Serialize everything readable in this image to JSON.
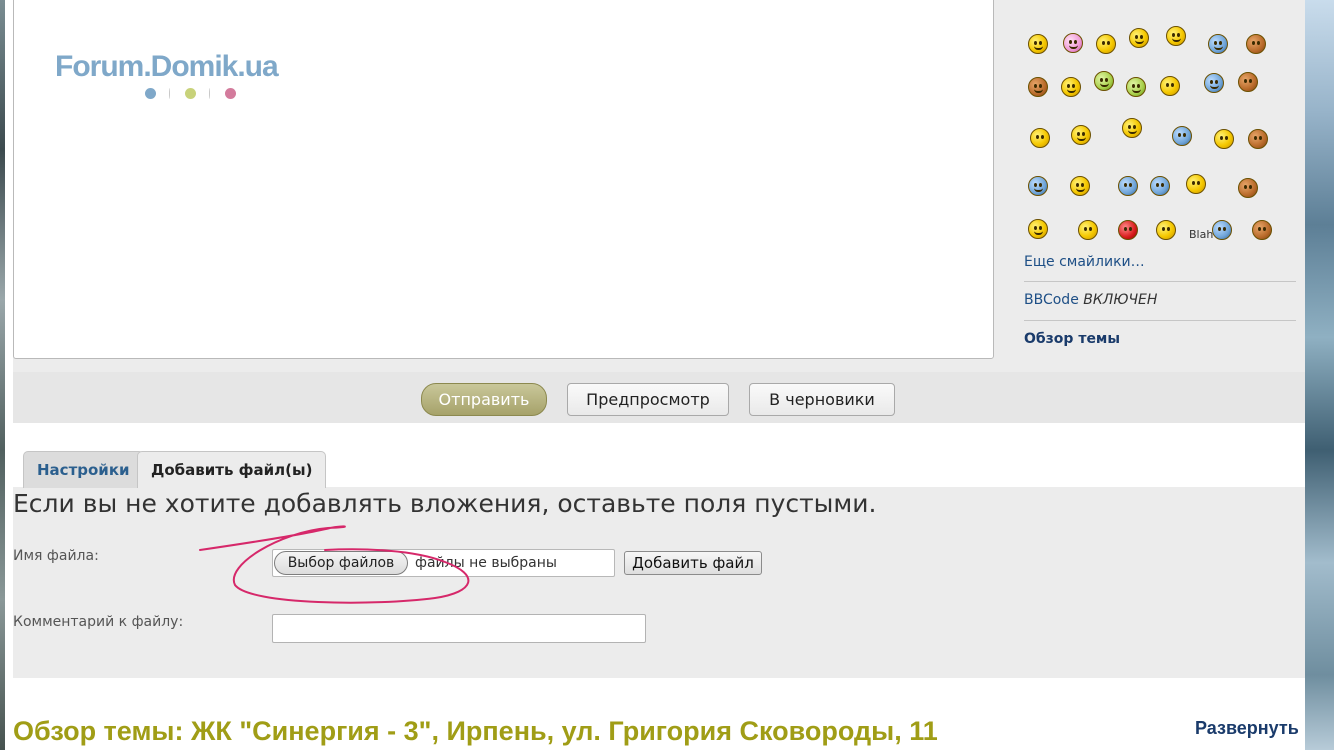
{
  "logo": {
    "text": "Forum.Domik.ua",
    "dot_colors": [
      "#7fa8c9",
      "#c8d27a",
      "#d37b9c"
    ]
  },
  "sidebar": {
    "more_smileys": "Еще смайлики…",
    "bbcode_label": "BBCode",
    "bbcode_state": "ВКЛЮЧЕН",
    "topic_overview": "Обзор темы",
    "blah_text": "Blah"
  },
  "buttons": {
    "submit": "Отправить",
    "preview": "Предпросмотр",
    "drafts": "В черновики"
  },
  "tabs": {
    "settings": "Настройки",
    "add_files": "Добавить файл(ы)"
  },
  "attachments": {
    "note": "Если вы не хотите добавлять вложения, оставьте поля пустыми.",
    "file_label": "Имя файла:",
    "choose_files": "Выбор файлов",
    "no_files": "файлы не выбраны",
    "add_file": "Добавить файл",
    "comment_label": "Комментарий к файлу:",
    "comment_value": ""
  },
  "topic": {
    "title": "Обзор темы: ЖК \"Синергия - 3\", Ирпень, ул. Григория Сковороды, 11",
    "expand": "Развернуть"
  },
  "colors": {
    "accent_olive": "#a09d16",
    "link_blue": "#1e4f86",
    "annotation_red": "#d6286a"
  }
}
